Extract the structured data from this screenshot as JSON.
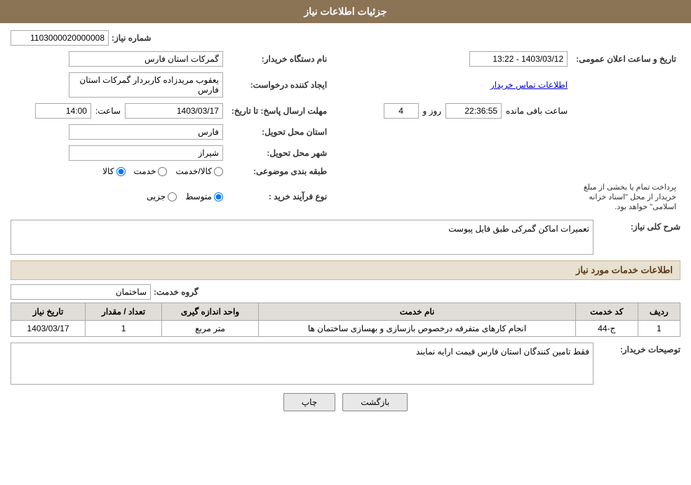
{
  "header": {
    "title": "جزئیات اطلاعات نیاز"
  },
  "fields": {
    "shomareNiaz_label": "شماره نیاز:",
    "shomareNiaz_value": "1103000020000008",
    "namDastgah_label": "نام دستگاه خریدار:",
    "namDastgah_value": "گمرکات استان فارس",
    "ijadKonande_label": "ایجاد کننده درخواست:",
    "ijadKonande_value": "یعقوب مریدزاده کاربردار گمرکات استان فارس",
    "ijadKonande_link": "اطلاعات تماس خریدار",
    "mohlat_label": "مهلت ارسال پاسخ: تا تاریخ:",
    "mohlat_date": "1403/03/17",
    "mohlat_saat_label": "ساعت:",
    "mohlat_saat": "14:00",
    "mohlat_roz_label": "روز و",
    "mohlat_roz": "4",
    "mohlat_baghimande_label": "ساعت باقی مانده",
    "mohlat_countdown": "22:36:55",
    "tarikheElan_label": "تاریخ و ساعت اعلان عمومی:",
    "tarikheElan_value": "1403/03/12 - 13:22",
    "ostan_label": "استان محل تحویل:",
    "ostan_value": "فارس",
    "shahr_label": "شهر محل تحویل:",
    "shahr_value": "شیراز",
    "tabaghe_label": "طبقه بندی موضوعی:",
    "tabaghe_options": [
      "کالا",
      "خدمت",
      "کالا/خدمت"
    ],
    "tabaghe_selected": "کالا",
    "noFarayand_label": "نوع فرآیند خرید :",
    "noFarayand_options": [
      "جزیی",
      "متوسط"
    ],
    "noFarayand_selected": "متوسط",
    "noFarayand_note": "پرداخت تمام یا بخشی از مبلغ خریدار از محل \"اسناد خزانه اسلامی\" خواهد بود.",
    "sharh_label": "شرح کلی نیاز:",
    "sharh_value": "تعمیرات اماکن گمرکی طبق فایل پیوست",
    "serviceSection_label": "اطلاعات خدمات مورد نیاز",
    "groheKhadmat_label": "گروه خدمت:",
    "groheKhadmat_value": "ساختمان",
    "table": {
      "headers": [
        "ردیف",
        "کد خدمت",
        "نام خدمت",
        "واحد اندازه گیری",
        "تعداد / مقدار",
        "تاریخ نیاز"
      ],
      "rows": [
        {
          "radif": "1",
          "kod": "ج-44",
          "nam": "انجام کارهای متفرقه درخصوص بازسازی و بهسازی ساختمان ها",
          "vahed": "متر مربع",
          "tedad": "1",
          "tarikh": "1403/03/17"
        }
      ]
    },
    "tosif_label": "توصیحات خریدار:",
    "tosif_value": "فقط تامین کنندگان استان فارس قیمت ارایه نمایند"
  },
  "buttons": {
    "print": "چاپ",
    "back": "بازگشت"
  }
}
